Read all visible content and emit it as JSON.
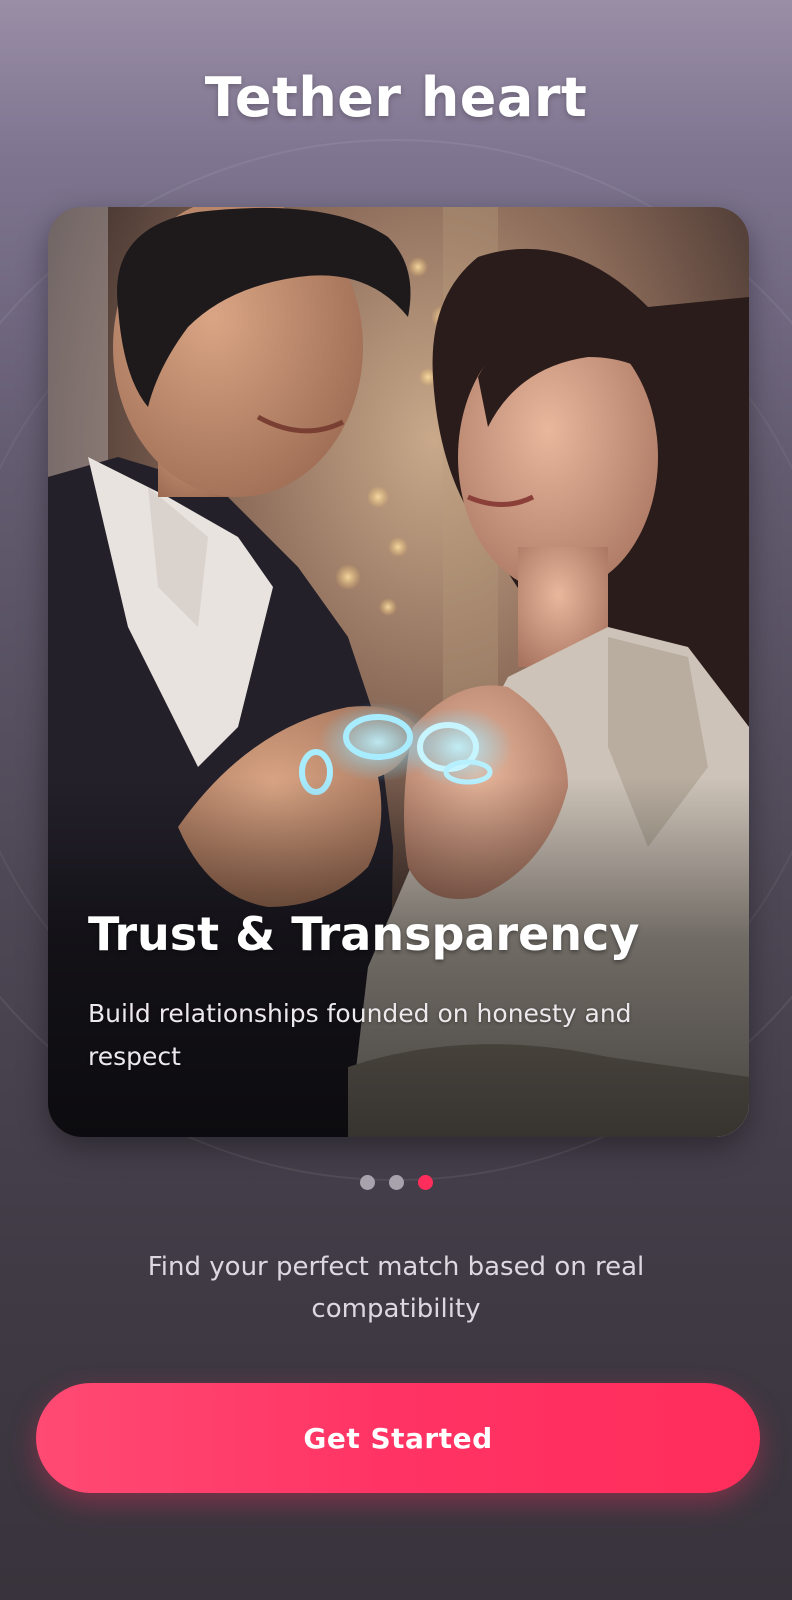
{
  "app": {
    "title": "Tether heart"
  },
  "carousel": {
    "slide_title": "Trust & Transparency",
    "slide_subtitle": "Build relationships founded on honesty and respect",
    "total_slides": 3,
    "active_index": 2
  },
  "tagline": "Find your perfect match based on real compatibility",
  "cta": {
    "label": "Get Started"
  },
  "colors": {
    "accent": "#ff2d5b",
    "dot_inactive": "#a8a2ad",
    "background_top": "#9a8ea6",
    "background_bottom": "#38333c"
  }
}
